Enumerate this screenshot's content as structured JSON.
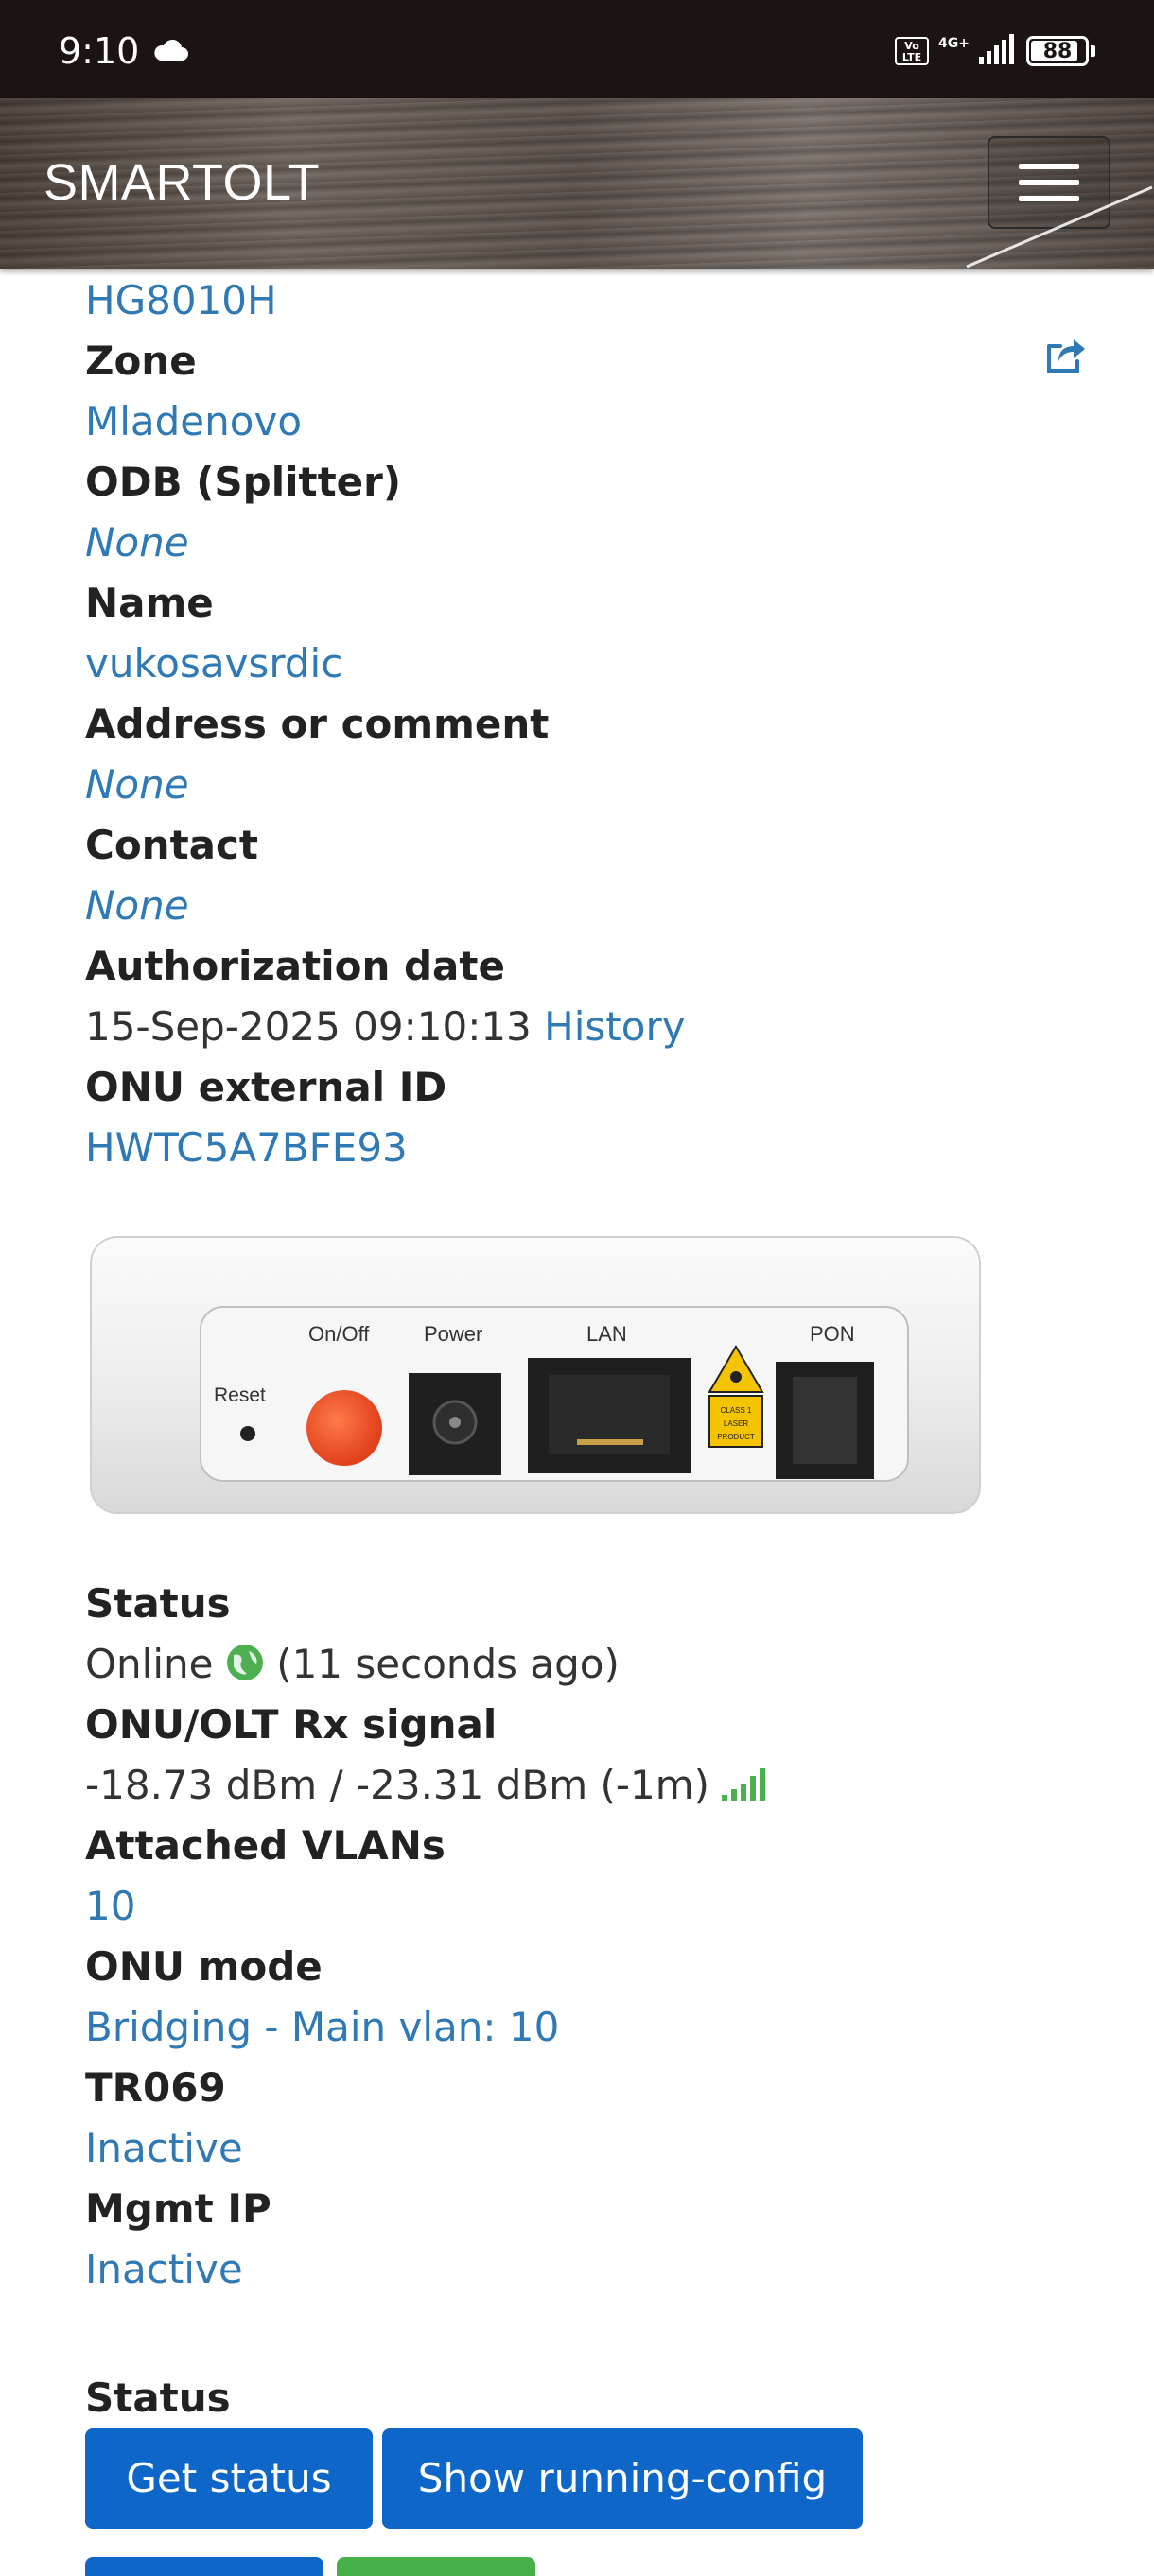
{
  "status_bar": {
    "time": "9:10",
    "network": "4G+",
    "volte": "VoLTE",
    "battery": "88",
    "battery_level": 0.88
  },
  "navbar": {
    "brand": "SMARTOLT"
  },
  "details": {
    "model": "HG8010H",
    "zone_label": "Zone",
    "zone_value": "Mladenovo",
    "odb_label": "ODB (Splitter)",
    "odb_value": "None",
    "name_label": "Name",
    "name_value": "vukosavsrdic",
    "address_label": "Address or comment",
    "address_value": "None",
    "contact_label": "Contact",
    "contact_value": "None",
    "auth_label": "Authorization date",
    "auth_value": "15-Sep-2025 09:10:13",
    "auth_history": "History",
    "ext_id_label": "ONU external ID",
    "ext_id_value": "HWTC5A7BFE93"
  },
  "device_image": {
    "labels": [
      "Reset",
      "On/Off",
      "Power",
      "LAN",
      "PON"
    ],
    "laser_label": "CLASS 1 LASER PRODUCT"
  },
  "status_info": {
    "status_label": "Status",
    "status_value": "Online",
    "status_ago": "(11 seconds ago)",
    "signal_label": "ONU/OLT Rx signal",
    "signal_value": "-18.73 dBm / -23.31 dBm (-1m)",
    "vlans_label": "Attached VLANs",
    "vlans_value": "10",
    "mode_label": "ONU mode",
    "mode_value": "Bridging - Main vlan: 10",
    "tr069_label": "TR069",
    "tr069_value": "Inactive",
    "mgmt_label": "Mgmt IP",
    "mgmt_value": "Inactive"
  },
  "actions": {
    "section_label": "Status",
    "get_status": "Get status",
    "show_running_config": "Show running-config"
  },
  "colors": {
    "link": "#2f79b5",
    "button_primary": "#0d66c8",
    "button_success": "#48b048",
    "online_globe": "#4caf50",
    "signal_bars": "#4caf50"
  }
}
